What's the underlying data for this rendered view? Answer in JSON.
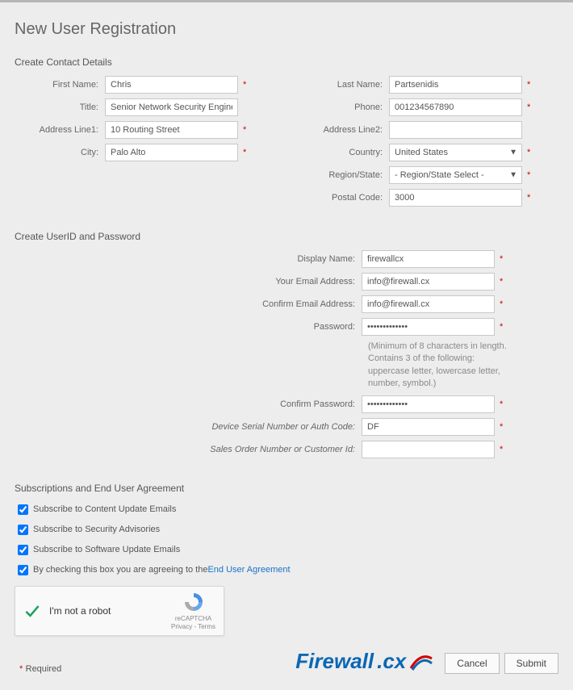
{
  "title": "New User Registration",
  "sections": {
    "contact": "Create Contact Details",
    "userid": "Create UserID and Password",
    "subs": "Subscriptions and End User Agreement"
  },
  "labels": {
    "firstName": "First Name:",
    "lastName": "Last Name:",
    "title": "Title:",
    "phone": "Phone:",
    "addr1": "Address Line1:",
    "addr2": "Address Line2:",
    "city": "City:",
    "country": "Country:",
    "region": "Region/State:",
    "postal": "Postal Code:",
    "displayName": "Display Name:",
    "email": "Your Email Address:",
    "confirmEmail": "Confirm Email Address:",
    "password": "Password:",
    "confirmPassword": "Confirm Password:",
    "deviceSerial": "Device Serial Number  or  Auth Code:",
    "salesOrder": "Sales Order Number  or  Customer Id:"
  },
  "values": {
    "firstName": "Chris",
    "lastName": "Partsenidis",
    "title": "Senior Network Security Engineer",
    "phone": "001234567890",
    "addr1": "10 Routing Street",
    "addr2": "",
    "city": "Palo Alto",
    "country": "United States",
    "region": "- Region/State Select -",
    "postal": "3000",
    "displayName": "firewallcx",
    "email": "info@firewall.cx",
    "confirmEmail": "info@firewall.cx",
    "password": "•••••••••••••",
    "confirmPassword": "•••••••••••••",
    "deviceSerial": "DF",
    "salesOrder": ""
  },
  "hint": "(Minimum of 8 characters in length. Contains 3 of the following: uppercase letter, lowercase letter, number, symbol.)",
  "subs": {
    "opt1": "Subscribe to Content Update Emails",
    "opt2": "Subscribe to Security Advisories",
    "opt3": "Subscribe to Software Update Emails",
    "opt4a": "By checking this box you are agreeing to the ",
    "opt4b": "End User Agreement"
  },
  "captcha": {
    "label": "I'm not a robot",
    "brand": "reCAPTCHA",
    "terms": "Privacy - Terms"
  },
  "footer": {
    "required": "Required",
    "cancel": "Cancel",
    "submit": "Submit"
  },
  "brand": {
    "a": "Firewall",
    "b": ".cx"
  },
  "asterisk": "*"
}
